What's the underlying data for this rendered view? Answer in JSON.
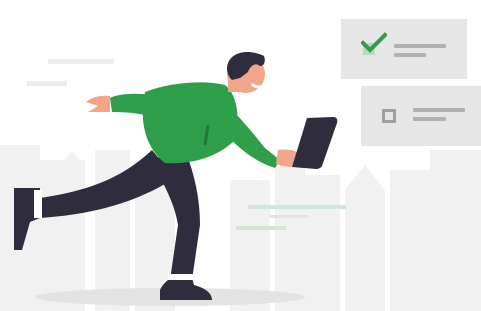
{
  "illustration": {
    "subject": "",
    "colors": {
      "background": "#ffffff",
      "skyline": "#efefef",
      "shirt": "#2e9e4a",
      "pants": "#2f2d3d",
      "skin": "#f3a58a",
      "hair": "#2f2d3d",
      "tablet": "#2f2d3d",
      "card": "#e6e6e6",
      "checkmark": "#2e9e4a",
      "shadow": "#e3e3e3"
    },
    "checklist": [
      {
        "checked": true
      },
      {
        "checked": false
      }
    ]
  }
}
